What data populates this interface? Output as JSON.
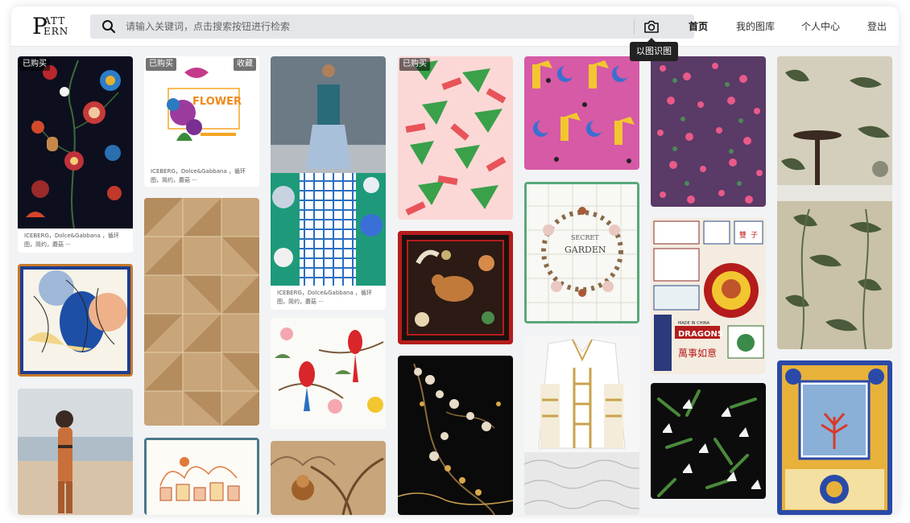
{
  "logo": {
    "line1": "P",
    "line2": "ATT",
    "line3": "ERN"
  },
  "search": {
    "placeholder": "请输入关键词，点击搜索按钮进行检索",
    "icon": "search-icon",
    "image_search_icon": "camera-icon",
    "image_search_tooltip": "以图识图"
  },
  "nav": {
    "home": "首页",
    "gallery": "我的图库",
    "personal": "个人中心",
    "logout": "登出"
  },
  "badges": {
    "purchased": "已购买",
    "collect": "收藏"
  },
  "captions": {
    "c1": "ICEBERG，Dolce&Gabbana ，循环图，简约，蘑菇 ···",
    "c2": "ICEBERG，Dolce&Gabbana ，循环图，简约，蘑菇 ···",
    "c3": "ICEBERG，Dolce&Gabbana ，循环图，简约，蘑菇 ···"
  },
  "cards": {
    "flower_text": "FLOWER",
    "secret_garden_1": "SECRET",
    "secret_garden_2": "GARDEN",
    "dragons": "DRAGONS",
    "made_in_china": "MADE IN CHINA",
    "wanshi": "萬事如意",
    "shuang": "雙",
    "zi": "子"
  },
  "colors": {
    "accent_dark": "#222222",
    "search_bg": "#e4e6ea",
    "page_bg": "#f2f3f5"
  }
}
